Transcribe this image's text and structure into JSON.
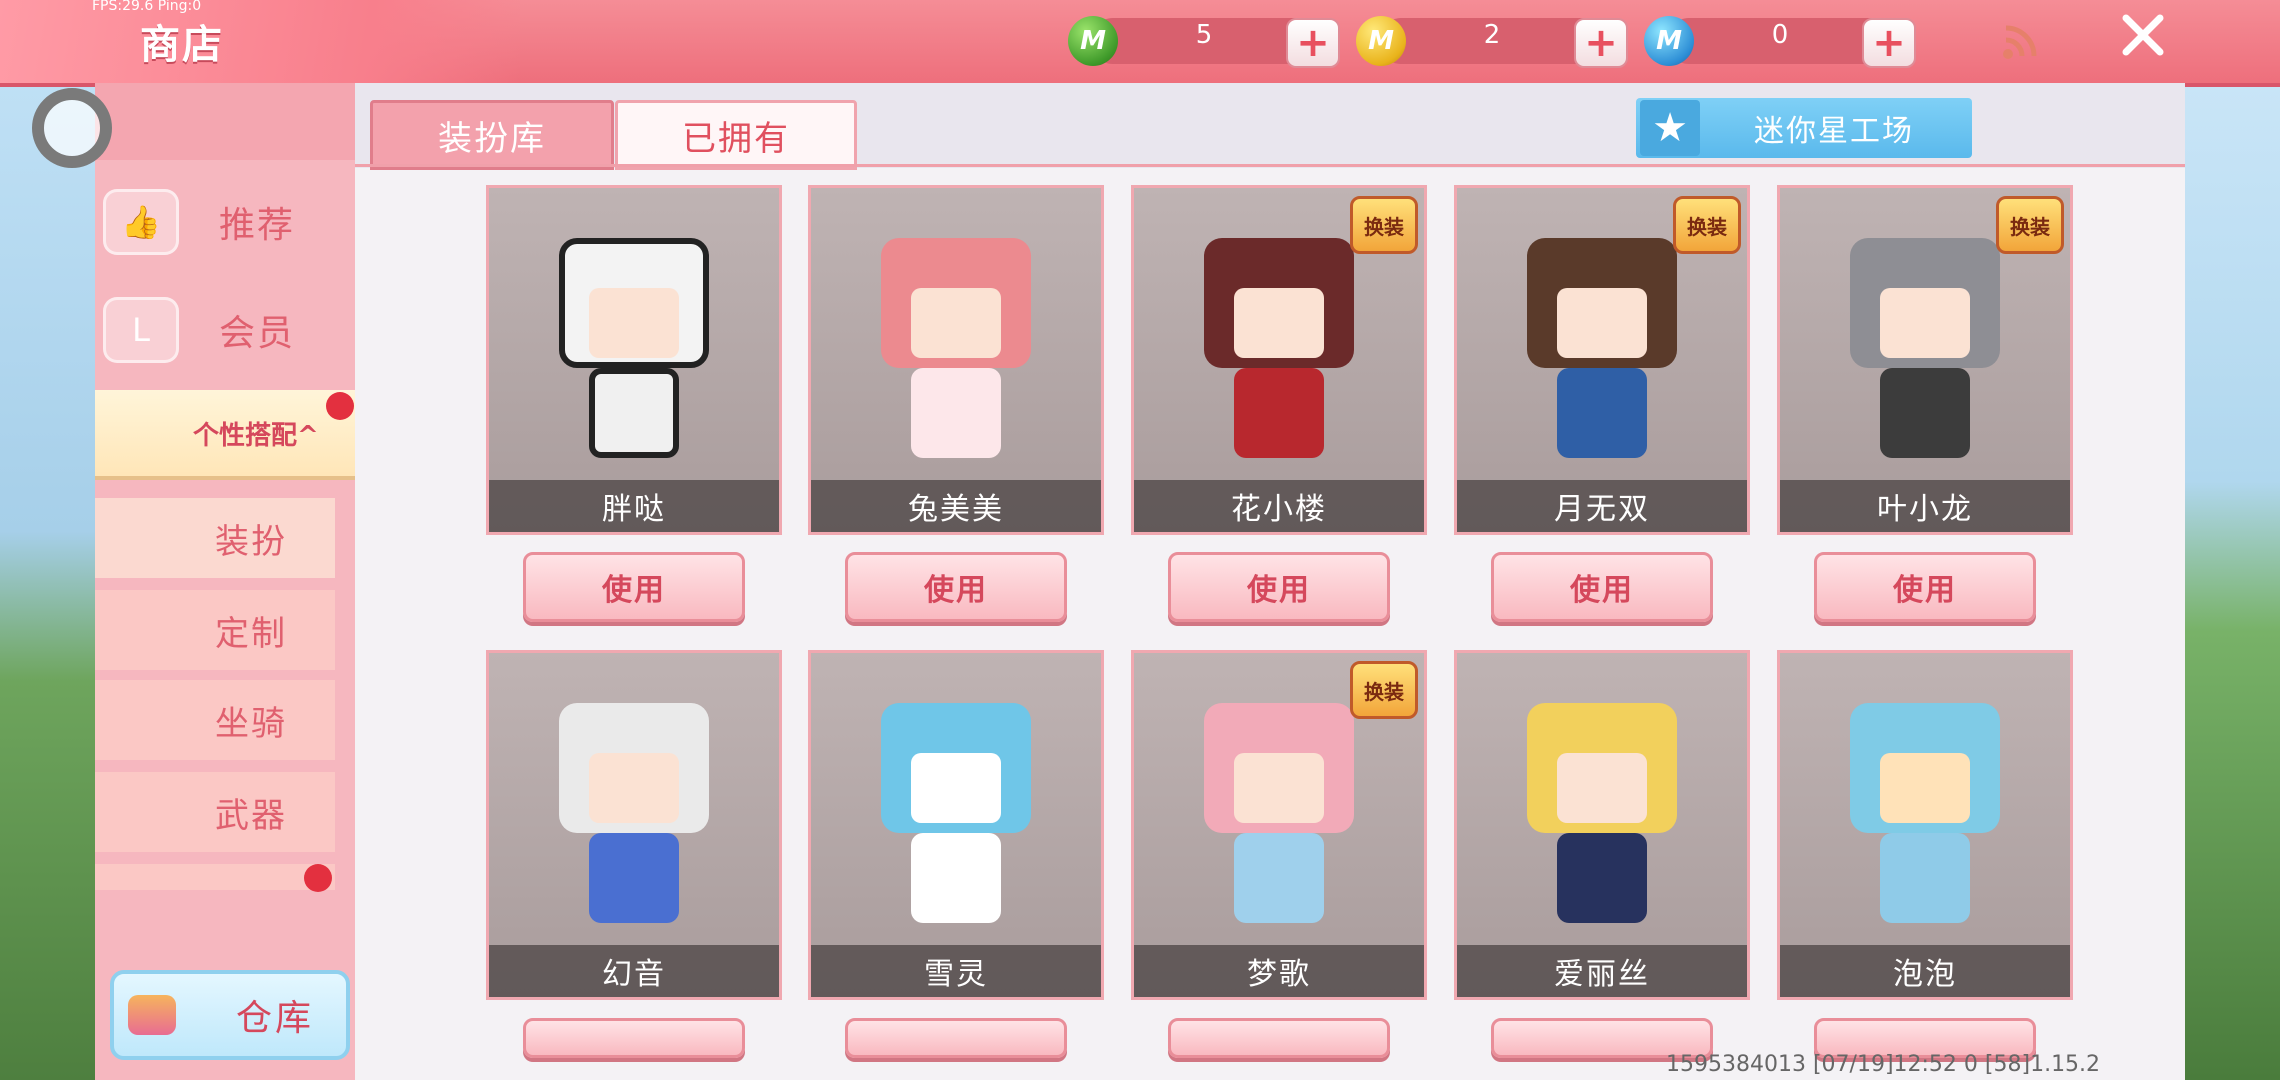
{
  "debug": {
    "fps": "FPS:29.6  Ping:0"
  },
  "header": {
    "title": "商店"
  },
  "currencies": [
    {
      "icon": "mini-bean-coin-icon",
      "symbol": "M",
      "value": "5"
    },
    {
      "icon": "mini-gold-coin-icon",
      "symbol": "M",
      "value": "2"
    },
    {
      "icon": "mini-blue-coin-icon",
      "symbol": "M",
      "value": "0"
    }
  ],
  "sidebar": {
    "items": [
      {
        "label": "推荐",
        "icon": "thumbs-up-icon"
      },
      {
        "label": "会员",
        "icon": "membership-icon"
      }
    ],
    "expanded": {
      "label": "个性搭配",
      "chevron": "^"
    },
    "sub_items": [
      {
        "label": "装扮",
        "icon": "tshirt-icon"
      },
      {
        "label": "定制",
        "icon": "pencil-icon"
      },
      {
        "label": "坐骑",
        "icon": "saddle-icon"
      },
      {
        "label": "武器",
        "icon": "gun-icon"
      }
    ],
    "warehouse": {
      "label": "仓库"
    }
  },
  "tabs": [
    {
      "label": "装扮库"
    },
    {
      "label": "已拥有"
    }
  ],
  "workshop": {
    "label": "迷你星工场"
  },
  "badge_text": "换装",
  "use_label": "使用",
  "skins": [
    {
      "name": "胖哒",
      "badge": false
    },
    {
      "name": "兔美美",
      "badge": false
    },
    {
      "name": "花小楼",
      "badge": true
    },
    {
      "name": "月无双",
      "badge": true
    },
    {
      "name": "叶小龙",
      "badge": true
    },
    {
      "name": "幻音",
      "badge": false
    },
    {
      "name": "雪灵",
      "badge": false
    },
    {
      "name": "梦歌",
      "badge": true
    },
    {
      "name": "爱丽丝",
      "badge": false
    },
    {
      "name": "泡泡",
      "badge": false
    }
  ],
  "footer": {
    "info": "1595384013   [07/19]12:52 0   [58]1.15.2"
  }
}
